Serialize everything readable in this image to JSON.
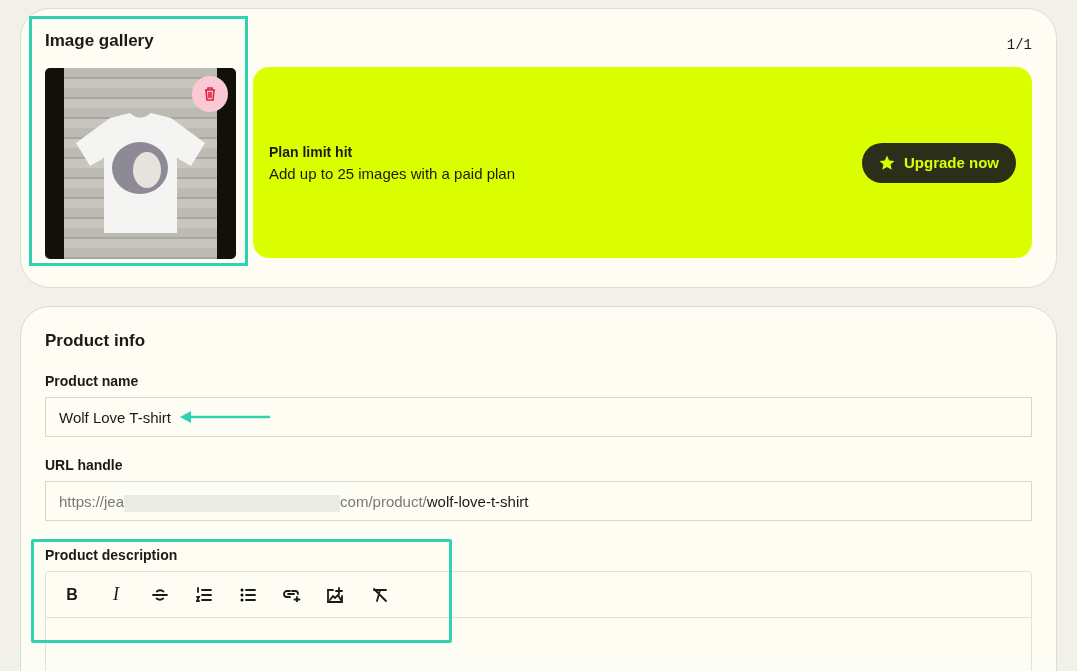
{
  "gallery": {
    "title": "Image gallery",
    "count": "1/1",
    "images": [
      {
        "kind": "photo"
      }
    ],
    "banner": {
      "title": "Plan limit hit",
      "text": "Add up to 25 images with a paid plan",
      "button": "Upgrade now"
    }
  },
  "product_info": {
    "title": "Product info",
    "name_field": {
      "label": "Product name",
      "value": "Wolf Love T-shirt"
    },
    "url_field": {
      "label": "URL handle",
      "prefix_start": "https://jea",
      "prefix_end": "com/product/",
      "value": "wolf-love-t-shirt"
    },
    "description": {
      "label": "Product description",
      "toolbar": [
        {
          "kind": "bold",
          "glyph": "B"
        },
        {
          "kind": "italic",
          "glyph": "I"
        },
        {
          "kind": "strike"
        },
        {
          "kind": "ordered"
        },
        {
          "kind": "bullets"
        },
        {
          "kind": "link"
        },
        {
          "kind": "media"
        },
        {
          "kind": "clear"
        }
      ]
    }
  }
}
